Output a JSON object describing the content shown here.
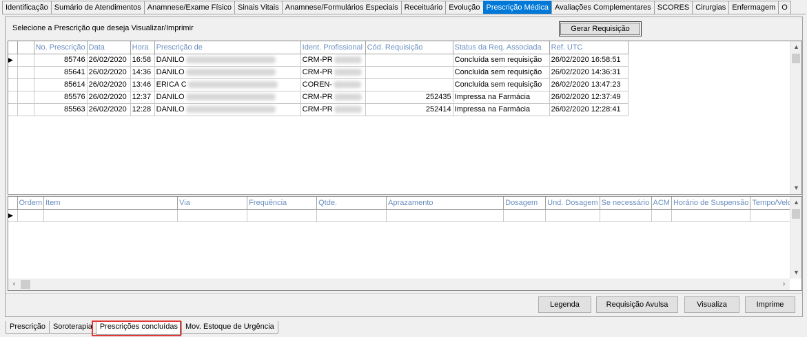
{
  "top_tabs": [
    {
      "label": "Identificação"
    },
    {
      "label": "Sumário de Atendimentos"
    },
    {
      "label": "Anamnese/Exame Físico"
    },
    {
      "label": "Sinais Vitais"
    },
    {
      "label": "Anamnese/Formulários Especiais"
    },
    {
      "label": "Receituário"
    },
    {
      "label": "Evolução"
    },
    {
      "label": "Prescrição Médica",
      "active": true
    },
    {
      "label": "Avaliações Complementares"
    },
    {
      "label": "SCORES"
    },
    {
      "label": "Cirurgias"
    },
    {
      "label": "Enfermagem"
    },
    {
      "label": "O"
    }
  ],
  "prompt_text": "Selecione a Prescrição que deseja Visualizar/Imprimir",
  "gerar_requisicao_label": "Gerar Requisição",
  "prescriptions": {
    "columns": [
      "No. Prescrição",
      "Data",
      "Hora",
      "Prescrição de",
      "Ident. Profissional",
      "Cód. Requisição",
      "Status da Req. Associada",
      "Ref. UTC"
    ],
    "rows": [
      {
        "numero": "85746",
        "data": "26/02/2020",
        "hora": "16:58",
        "prescricao_de": "DANILO",
        "ident": "CRM-PR",
        "cod": "",
        "status": "Concluída sem requisição",
        "utc": "26/02/2020 16:58:51",
        "selected": true
      },
      {
        "numero": "85641",
        "data": "26/02/2020",
        "hora": "14:36",
        "prescricao_de": "DANILO",
        "ident": "CRM-PR",
        "cod": "",
        "status": "Concluída sem requisição",
        "utc": "26/02/2020 14:36:31"
      },
      {
        "numero": "85614",
        "data": "26/02/2020",
        "hora": "13:46",
        "prescricao_de": "ERICA C",
        "ident": "COREN-",
        "cod": "",
        "status": "Concluída sem requisição",
        "utc": "26/02/2020 13:47:23"
      },
      {
        "numero": "85576",
        "data": "26/02/2020",
        "hora": "12:37",
        "prescricao_de": "DANILO",
        "ident": "CRM-PR",
        "cod": "252435",
        "status": "Impressa na Farmácia",
        "utc": "26/02/2020 12:37:49"
      },
      {
        "numero": "85563",
        "data": "26/02/2020",
        "hora": "12:28",
        "prescricao_de": "DANILO",
        "ident": "CRM-PR",
        "cod": "252414",
        "status": "Impressa na Farmácia",
        "utc": "26/02/2020 12:28:41"
      }
    ]
  },
  "items": {
    "columns": [
      "Ordem",
      "Item",
      "Via",
      "Frequência",
      "Qtde.",
      "Aprazamento",
      "Dosagem",
      "Und. Dosagem",
      "Se necessário",
      "ACM",
      "Horário de Suspensão",
      "Tempo/Velo"
    ]
  },
  "buttons": {
    "legenda": "Legenda",
    "requisicao_avulsa": "Requisição Avulsa",
    "visualiza": "Visualiza",
    "imprime": "Imprime"
  },
  "bottom_tabs": [
    {
      "label": "Prescrição"
    },
    {
      "label": "Soroterapia"
    },
    {
      "label": "Prescrições concluídas",
      "active": true
    },
    {
      "label": "Mov. Estoque de Urgência"
    }
  ],
  "colors": {
    "active_tab": "#0078d7",
    "header_text": "#6a8fc0",
    "highlight_box": "#e53935"
  }
}
